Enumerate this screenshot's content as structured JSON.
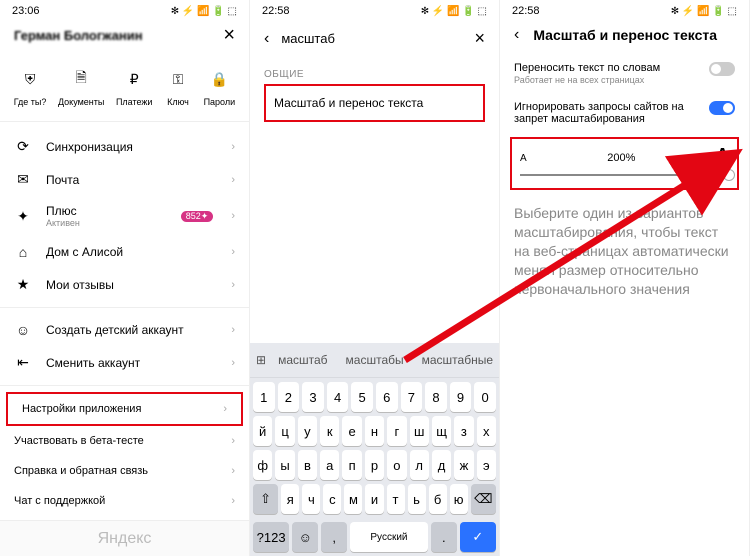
{
  "status": {
    "t1": "23:06",
    "t2": "22:58",
    "t3": "22:58",
    "icons": "✻ ⚡ 📶 🔋 ⬚"
  },
  "p1": {
    "name": "Герман Бологжанин",
    "quick": [
      {
        "ico": "⛨",
        "label": "Где ты?"
      },
      {
        "ico": "🗎",
        "label": "Документы"
      },
      {
        "ico": "₽",
        "label": "Платежи"
      },
      {
        "ico": "⚿",
        "label": "Ключ"
      },
      {
        "ico": "🔒",
        "label": "Пароли"
      }
    ],
    "rows": [
      {
        "ico": "⟳",
        "label": "Синхронизация"
      },
      {
        "ico": "✉",
        "label": "Почта"
      },
      {
        "ico": "✦",
        "label": "Плюс",
        "sub": "Активен",
        "badge": "852✦"
      },
      {
        "ico": "⌂",
        "label": "Дом с Алисой"
      },
      {
        "ico": "★",
        "label": "Мои отзывы"
      },
      {
        "ico": "☺",
        "label": "Создать детский аккаунт"
      },
      {
        "ico": "⇤",
        "label": "Сменить аккаунт"
      }
    ],
    "settings": "Настройки приложения",
    "beta": "Участвовать в бета-тесте",
    "help": "Справка и обратная связь",
    "chat": "Чат с поддержкой",
    "brand": "Яндекс"
  },
  "p2": {
    "query": "масштаб",
    "section": "ОБЩИЕ",
    "result": "Масштаб и перенос текста",
    "suggestions": [
      "масштаб",
      "масштабы",
      "масштабные"
    ],
    "rows": [
      [
        "1",
        "2",
        "3",
        "4",
        "5",
        "6",
        "7",
        "8",
        "9",
        "0"
      ],
      [
        "й",
        "ц",
        "у",
        "к",
        "е",
        "н",
        "г",
        "ш",
        "щ",
        "з",
        "х"
      ],
      [
        "ф",
        "ы",
        "в",
        "а",
        "п",
        "р",
        "о",
        "л",
        "д",
        "ж",
        "э"
      ],
      [
        "⇧",
        "я",
        "ч",
        "с",
        "м",
        "и",
        "т",
        "ь",
        "б",
        "ю",
        "⌫"
      ]
    ],
    "bottom": {
      "sym": "?123",
      "emoji": "☺",
      "comma": ",",
      "space": "Русский",
      "dot": ".",
      "ok": "✓"
    }
  },
  "p3": {
    "title": "Масштаб и перенос текста",
    "opt1": {
      "label": "Переносить текст по словам",
      "sub": "Работает не на всех страницах"
    },
    "opt2": {
      "label": "Игнорировать запросы сайтов на запрет масштабирования"
    },
    "slider": {
      "small": "A",
      "val": "200%",
      "big": "A"
    },
    "desc": "Выберите один из вариантов масштабирования, чтобы текст на веб-страницах автоматически менял размер относительно первоначального значения"
  }
}
